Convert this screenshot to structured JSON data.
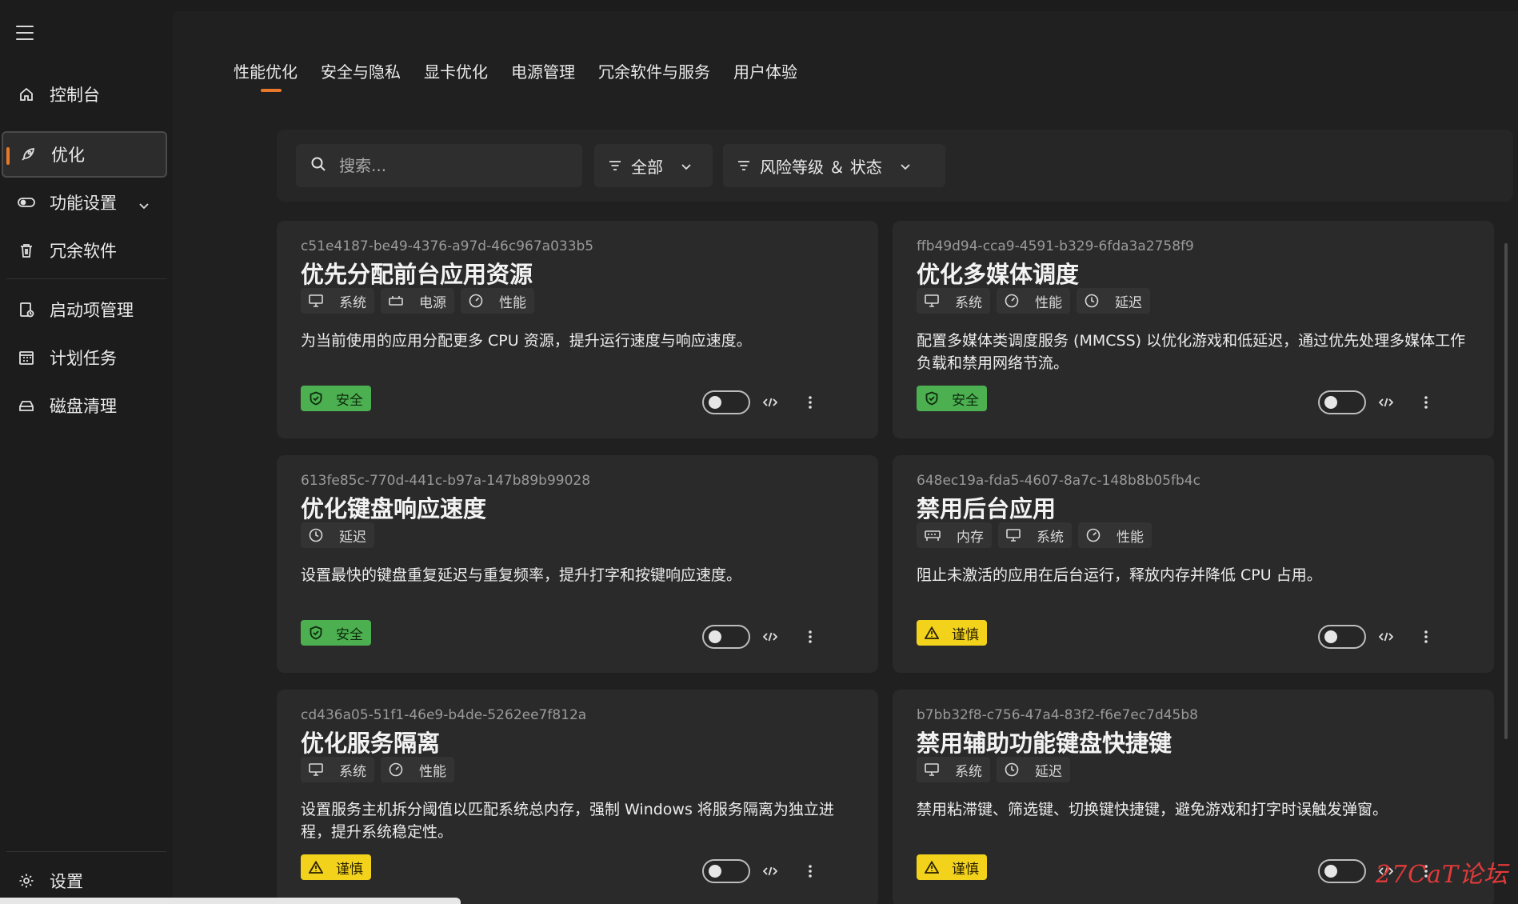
{
  "sidebar": {
    "items": [
      {
        "label": "控制台",
        "icon": "home-icon"
      },
      {
        "label": "优化",
        "icon": "rocket-icon"
      },
      {
        "label": "功能设置",
        "icon": "toggle-icon"
      },
      {
        "label": "冗余软件",
        "icon": "trash-icon"
      },
      {
        "label": "启动项管理",
        "icon": "startup-icon"
      },
      {
        "label": "计划任务",
        "icon": "calendar-icon"
      },
      {
        "label": "磁盘清理",
        "icon": "disk-icon"
      }
    ],
    "settings_label": "设置"
  },
  "tabs": [
    "性能优化",
    "安全与隐私",
    "显卡优化",
    "电源管理",
    "冗余软件与服务",
    "用户体验"
  ],
  "active_tab": "性能优化",
  "accent_color": "#e8782a",
  "toolbar": {
    "search_placeholder": "搜索...",
    "category_filter": "全部",
    "risk_filter": "风险等级 ＆ 状态"
  },
  "cards": [
    {
      "uid": "c51e4187-be49-4376-a97d-46c967a033b5",
      "title": "优先分配前台应用资源",
      "tags": [
        {
          "label": "系统",
          "icon": "monitor-icon"
        },
        {
          "label": "电源",
          "icon": "power-icon"
        },
        {
          "label": "性能",
          "icon": "gauge-icon"
        }
      ],
      "desc": "为当前使用的应用分配更多 CPU 资源，提升运行速度与响应速度。",
      "risk": "安全",
      "risk_type": "safe",
      "enabled": false
    },
    {
      "uid": "ffb49d94-cca9-4591-b329-6fda3a2758f9",
      "title": "优化多媒体调度",
      "tags": [
        {
          "label": "系统",
          "icon": "monitor-icon"
        },
        {
          "label": "性能",
          "icon": "gauge-icon"
        },
        {
          "label": "延迟",
          "icon": "clock-icon"
        }
      ],
      "desc": "配置多媒体类调度服务 (MMCSS) 以优化游戏和低延迟，通过优先处理多媒体工作负载和禁用网络节流。",
      "risk": "安全",
      "risk_type": "safe",
      "enabled": false
    },
    {
      "uid": "613fe85c-770d-441c-b97a-147b89b99028",
      "title": "优化键盘响应速度",
      "tags": [
        {
          "label": "延迟",
          "icon": "clock-icon"
        }
      ],
      "desc": "设置最快的键盘重复延迟与重复频率，提升打字和按键响应速度。",
      "risk": "安全",
      "risk_type": "safe",
      "enabled": false
    },
    {
      "uid": "648ec19a-fda5-4607-8a7c-148b8b05fb4c",
      "title": "禁用后台应用",
      "tags": [
        {
          "label": "内存",
          "icon": "memory-icon"
        },
        {
          "label": "系统",
          "icon": "monitor-icon"
        },
        {
          "label": "性能",
          "icon": "gauge-icon"
        }
      ],
      "desc": "阻止未激活的应用在后台运行，释放内存并降低 CPU 占用。",
      "risk": "谨慎",
      "risk_type": "caution",
      "enabled": false
    },
    {
      "uid": "cd436a05-51f1-46e9-b4de-5262ee7f812a",
      "title": "优化服务隔离",
      "tags": [
        {
          "label": "系统",
          "icon": "monitor-icon"
        },
        {
          "label": "性能",
          "icon": "gauge-icon"
        }
      ],
      "desc": "设置服务主机拆分阈值以匹配系统总内存，强制 Windows 将服务隔离为独立进程，提升系统稳定性。",
      "risk": "谨慎",
      "risk_type": "caution",
      "enabled": false
    },
    {
      "uid": "b7bb32f8-c756-47a4-83f2-f6e7ec7d45b8",
      "title": "禁用辅助功能键盘快捷键",
      "tags": [
        {
          "label": "系统",
          "icon": "monitor-icon"
        },
        {
          "label": "延迟",
          "icon": "clock-icon"
        }
      ],
      "desc": "禁用粘滞键、筛选键、切换键快捷键，避免游戏和打字时误触发弹窗。",
      "risk": "谨慎",
      "risk_type": "caution",
      "enabled": false
    }
  ],
  "watermark": "27CaT论坛"
}
